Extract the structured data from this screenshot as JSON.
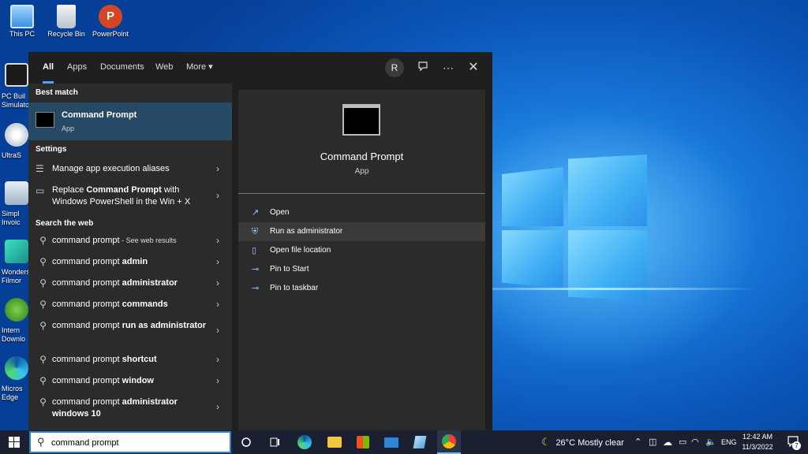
{
  "desktop": {
    "icons": [
      {
        "label": "This PC",
        "icon": "this-pc-icon"
      },
      {
        "label": "Recycle Bin",
        "icon": "recycle-bin-icon"
      },
      {
        "label": "PowerPoint",
        "icon": "powerpoint-icon"
      }
    ],
    "side_icons": [
      {
        "label": "PC Buil Simulato",
        "icon": "pc-building-simulator-icon"
      },
      {
        "label": "UltraS",
        "icon": "ultraiso-icon"
      },
      {
        "label": "Simpl Invoic",
        "icon": "simple-invoice-icon"
      },
      {
        "label": "Wonders Filmor",
        "icon": "wondershare-filmora-icon"
      },
      {
        "label": "Intern Downlo",
        "icon": "internet-download-manager-icon"
      },
      {
        "label": "Micros Edge",
        "icon": "microsoft-edge-icon"
      }
    ]
  },
  "search": {
    "tabs": [
      "All",
      "Apps",
      "Documents",
      "Web",
      "More"
    ],
    "more_arrow": "▾",
    "avatar_letter": "R",
    "best_match": {
      "section": "Best match",
      "title": "Command Prompt",
      "subtitle": "App"
    },
    "settings": {
      "section": "Settings",
      "items": [
        {
          "text": "Manage app execution aliases"
        },
        {
          "text_pre": "Replace ",
          "text_bold": "Command Prompt",
          "text_post": " with Windows PowerShell in the Win + X"
        }
      ]
    },
    "web": {
      "section": "Search the web",
      "items": [
        {
          "base": "command prompt",
          "bold": "",
          "suffix": " - See web results"
        },
        {
          "base": "command prompt ",
          "bold": "admin",
          "suffix": ""
        },
        {
          "base": "command prompt ",
          "bold": "administrator",
          "suffix": ""
        },
        {
          "base": "command prompt ",
          "bold": "commands",
          "suffix": ""
        },
        {
          "base": "command prompt ",
          "bold": "run as administrator",
          "suffix": ""
        },
        {
          "base": "command prompt ",
          "bold": "shortcut",
          "suffix": ""
        },
        {
          "base": "command prompt ",
          "bold": "window",
          "suffix": ""
        },
        {
          "base": "command prompt ",
          "bold": "administrator windows 10",
          "suffix": ""
        }
      ]
    },
    "preview": {
      "title": "Command Prompt",
      "subtitle": "App",
      "actions": [
        "Open",
        "Run as administrator",
        "Open file location",
        "Pin to Start",
        "Pin to taskbar"
      ]
    },
    "query": "command prompt"
  },
  "taskbar": {
    "weather": "26°C  Mostly clear",
    "language": "ENG",
    "time": "12:42 AM",
    "date": "11/3/2022",
    "notification_count": "7"
  }
}
